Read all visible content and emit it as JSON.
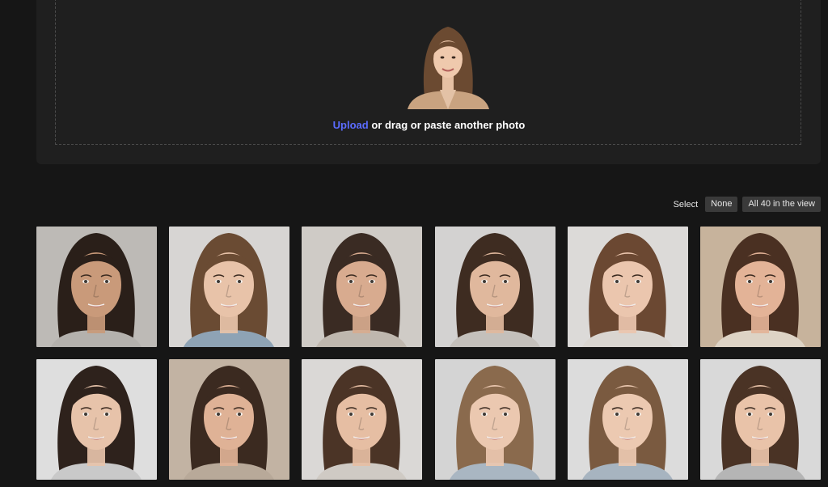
{
  "upload": {
    "link_text": "Upload",
    "rest_text": "or drag or paste another photo",
    "preview_icon": "portrait-photo",
    "accent_color": "#5b6cff"
  },
  "selection": {
    "label": "Select",
    "none_label": "None",
    "all_label": "All 40 in the view"
  },
  "faces": [
    {
      "icon": "portrait-photo",
      "bg": "#bdbab6",
      "hair": "#2a1f19",
      "skin": "#c99a7a",
      "shirt": "#b4b1ad"
    },
    {
      "icon": "portrait-photo",
      "bg": "#d7d5d3",
      "hair": "#6a4b33",
      "skin": "#e8c3a9",
      "shirt": "#8ea3b5"
    },
    {
      "icon": "portrait-photo",
      "bg": "#cfcbc6",
      "hair": "#3a2b23",
      "skin": "#d8ab8f",
      "shirt": "#bfb7ae"
    },
    {
      "icon": "portrait-photo",
      "bg": "#d3d2d1",
      "hair": "#3e2c21",
      "skin": "#e0b89d",
      "shirt": "#c4c0bb"
    },
    {
      "icon": "portrait-photo",
      "bg": "#dcdad8",
      "hair": "#6b4832",
      "skin": "#ebc6ae",
      "shirt": "#d9d5d0"
    },
    {
      "icon": "portrait-photo",
      "bg": "#c7b39c",
      "hair": "#4a3022",
      "skin": "#e3b397",
      "shirt": "#ddd3c5"
    },
    {
      "icon": "portrait-photo",
      "bg": "#dedede",
      "hair": "#2e221c",
      "skin": "#e7c3aa",
      "shirt": "#c9c9c9"
    },
    {
      "icon": "portrait-photo",
      "bg": "#c2b3a3",
      "hair": "#3b2a20",
      "skin": "#dfb296",
      "shirt": "#b8a999"
    },
    {
      "icon": "portrait-photo",
      "bg": "#dad8d6",
      "hair": "#4b3426",
      "skin": "#e6bea3",
      "shirt": "#cfcac4"
    },
    {
      "icon": "portrait-photo",
      "bg": "#d4d4d4",
      "hair": "#8a6a4d",
      "skin": "#ebc8b0",
      "shirt": "#a9b6c2"
    },
    {
      "icon": "portrait-photo",
      "bg": "#dcdcdc",
      "hair": "#7a5a40",
      "skin": "#ecc9b1",
      "shirt": "#a7b4c0"
    },
    {
      "icon": "portrait-photo",
      "bg": "#d9d9d9",
      "hair": "#4a3325",
      "skin": "#e9c3a9",
      "shirt": "#b5b5b5"
    }
  ]
}
